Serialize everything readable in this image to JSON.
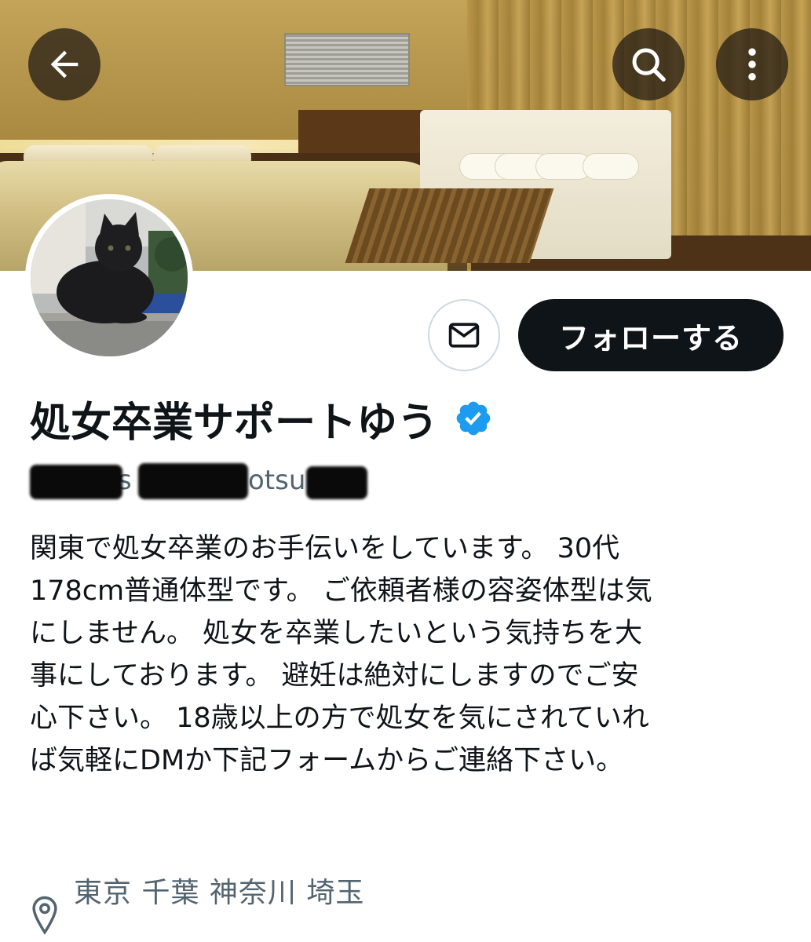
{
  "header": {
    "back_icon": "arrow-left-icon",
    "search_icon": "search-icon",
    "more_icon": "more-vertical-icon"
  },
  "profile": {
    "display_name": "処女卒業サポートゆう",
    "verified": true,
    "verified_color": "#1d9bf0",
    "handle_fragment_1": "s",
    "handle_fragment_2": "otsu",
    "bio_lines": [
      "関東で処女卒業のお手伝いをしています。 30代",
      "178cm普通体型です。 ご依頼者様の容姿体型は気",
      "にしません。 処女を卒業したいという気持ちを大",
      "事にしております。 避妊は絶対にしますのでご安",
      "心下さい。 18歳以上の方で処女を気にされていれ",
      "ば気軽にDMか下記フォームからご連絡下さい。"
    ],
    "location": "東京 千葉 神奈川 埼玉",
    "location_icon": "location-pin-icon"
  },
  "actions": {
    "message_icon": "envelope-icon",
    "follow_label": "フォローする"
  },
  "colors": {
    "text_primary": "#0f1419",
    "text_secondary": "#536471",
    "follow_bg": "#0f1419",
    "border": "#cfd9de"
  }
}
